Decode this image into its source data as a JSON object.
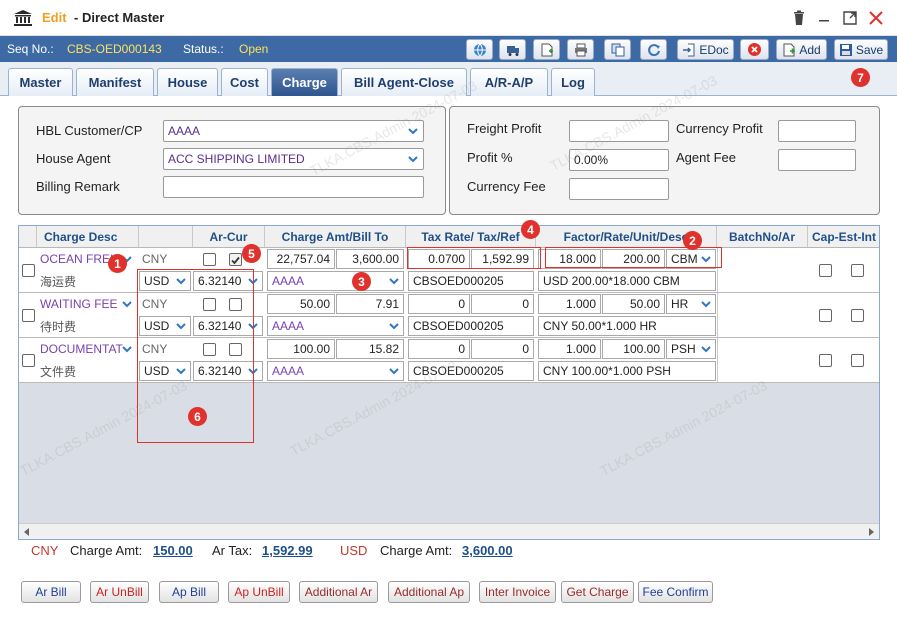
{
  "title": {
    "edit": "Edit",
    "dash": " - ",
    "name": "Direct Master"
  },
  "seq": {
    "seq_label": "Seq No.:",
    "seq_value": "CBS-OED000143",
    "status_label": "Status.:",
    "status_value": "Open"
  },
  "toolbar": {
    "edoc": "EDoc",
    "add": "Add",
    "save": "Save"
  },
  "tabs": [
    "Master",
    "Manifest",
    "House",
    "Cost",
    "Charge",
    "Bill Agent-Close",
    "A/R-A/P",
    "Log"
  ],
  "active_tab": "Charge",
  "form": {
    "hbl_customer_label": "HBL Customer/CP",
    "hbl_customer_value": "AAAA",
    "house_agent_label": "House Agent",
    "house_agent_value": "ACC SHIPPING LIMITED",
    "billing_remark_label": "Billing Remark",
    "billing_remark_value": "",
    "freight_profit_label": "Freight Profit",
    "freight_profit_value": "",
    "profit_pct_label": "Profit %",
    "profit_pct_value": "0.00%",
    "currency_fee_label": "Currency Fee",
    "currency_fee_value": "",
    "currency_profit_label": "Currency Profit",
    "currency_profit_value": "",
    "agent_fee_label": "Agent Fee",
    "agent_fee_value": ""
  },
  "grid": {
    "headers": [
      "Charge Desc",
      "Ar-Cur",
      "Charge Amt/Bill To",
      "Tax Rate/ Tax/Ref",
      "Factor/Rate/Unit/Desc",
      "BatchNo/Ar",
      "Cap-Est-Int"
    ],
    "rows": [
      {
        "desc": "OCEAN FREIGHT",
        "desc_cn": "海运费",
        "cur": "CNY",
        "ap_cur": "USD",
        "rate": "6.32140",
        "amt": "22,757.04",
        "bill_amt": "3,600.00",
        "bill_to": "AAAA",
        "tax_rate": "0.0700",
        "tax": "1,592.99",
        "ref": "CBSOED000205",
        "factor": "18.000",
        "unit_rate": "200.00",
        "unit": "CBM",
        "desc_text": "USD 200.00*18.000 CBM",
        "checked2": true
      },
      {
        "desc": "WAITING FEE",
        "desc_cn": "待时费",
        "cur": "CNY",
        "ap_cur": "USD",
        "rate": "6.32140",
        "amt": "50.00",
        "bill_amt": "7.91",
        "bill_to": "AAAA",
        "tax_rate": "0",
        "tax": "0",
        "ref": "CBSOED000205",
        "factor": "1.000",
        "unit_rate": "50.00",
        "unit": "HR",
        "desc_text": "CNY 50.00*1.000 HR",
        "checked2": false
      },
      {
        "desc": "DOCUMENTATION",
        "desc_cn": "文件费",
        "cur": "CNY",
        "ap_cur": "USD",
        "rate": "6.32140",
        "amt": "100.00",
        "bill_amt": "15.82",
        "bill_to": "AAAA",
        "tax_rate": "0",
        "tax": "0",
        "ref": "CBSOED000205",
        "factor": "1.000",
        "unit_rate": "100.00",
        "unit": "PSH",
        "desc_text": "CNY 100.00*1.000 PSH",
        "checked2": false
      }
    ]
  },
  "totals": {
    "cny_label": "CNY",
    "cny_charge_label": "Charge Amt:",
    "cny_charge_value": "150.00",
    "ar_tax_label": "Ar Tax:",
    "ar_tax_value": "1,592.99",
    "usd_label": "USD",
    "usd_charge_label": "Charge Amt:",
    "usd_charge_value": "3,600.00"
  },
  "buttons": [
    "Ar Bill",
    "Ar UnBill",
    "Ap Bill",
    "Ap UnBill",
    "Additional Ar",
    "Additional Ap",
    "Inter Invoice",
    "Get Charge",
    "Fee Confirm"
  ],
  "badges": [
    "1",
    "2",
    "3",
    "4",
    "5",
    "6",
    "7"
  ],
  "watermark": "TLKA.CBS.Admin 2024-07-03",
  "colors": {
    "header_blue": "#3d6aa5",
    "seq_value": "#ffe25a",
    "edit": "#f0a020",
    "badge": "#e0312c",
    "link": "#1e4f8a"
  }
}
